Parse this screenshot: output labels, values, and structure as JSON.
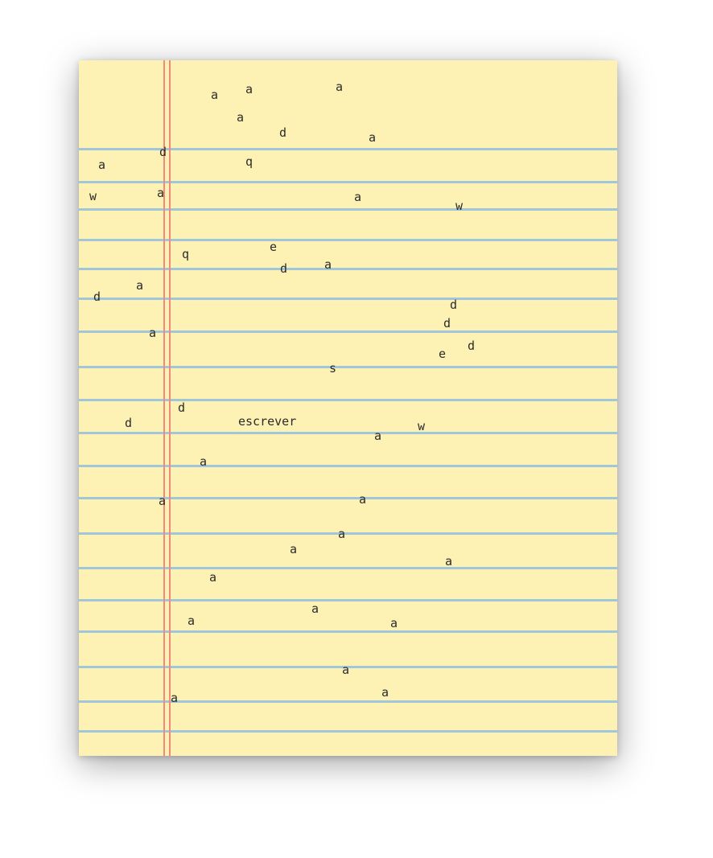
{
  "paper": {
    "background": "#fdf1b4",
    "rule_color": "#9fc6d9",
    "margin_color": "#ef8a7c"
  },
  "typed_text": {
    "word": "escrever",
    "letters": [
      "a",
      "a",
      "a",
      "a",
      "d",
      "a",
      "d",
      "a",
      "q",
      "w",
      "a",
      "a",
      "w",
      "q",
      "e",
      "d",
      "a",
      "a",
      "d",
      "d",
      "d",
      "a",
      "e",
      "d",
      "s",
      "d",
      "d",
      "a",
      "w",
      "a",
      "a",
      "a",
      "a",
      "a",
      "a",
      "a",
      "a",
      "a",
      "a",
      "a",
      "a",
      "a"
    ]
  }
}
